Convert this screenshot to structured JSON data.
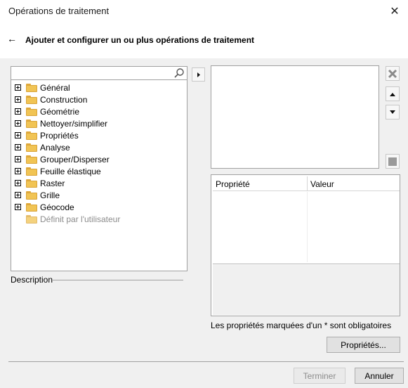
{
  "window": {
    "title": "Opérations de traitement",
    "close_glyph": "✕"
  },
  "header": {
    "back_glyph": "←",
    "heading": "Ajouter et configurer un ou plus opérations de traitement"
  },
  "search": {
    "value": "",
    "icon": "search-icon"
  },
  "tree": {
    "items": [
      {
        "label": "Général",
        "expandable": true
      },
      {
        "label": "Construction",
        "expandable": true
      },
      {
        "label": "Géométrie",
        "expandable": true
      },
      {
        "label": "Nettoyer/simplifier",
        "expandable": true
      },
      {
        "label": "Propriétés",
        "expandable": true
      },
      {
        "label": "Analyse",
        "expandable": true
      },
      {
        "label": "Grouper/Disperser",
        "expandable": true
      },
      {
        "label": "Feuille élastique",
        "expandable": true
      },
      {
        "label": "Raster",
        "expandable": true
      },
      {
        "label": "Grille",
        "expandable": true
      },
      {
        "label": "Géocode",
        "expandable": true
      },
      {
        "label": "Définit par l'utilisateur",
        "expandable": false,
        "disabled": true
      }
    ]
  },
  "description": {
    "label": "Description"
  },
  "properties": {
    "col_property": "Propriété",
    "col_value": "Valeur",
    "required_note": "Les propriétés marquées d'un * sont obligatoires"
  },
  "buttons": {
    "properties": "Propriétés...",
    "finish": "Terminer",
    "cancel": "Annuler"
  },
  "colors": {
    "folder": "#f1c454",
    "window_bg": "#f0f0f0",
    "header_bg": "#ffffff"
  }
}
